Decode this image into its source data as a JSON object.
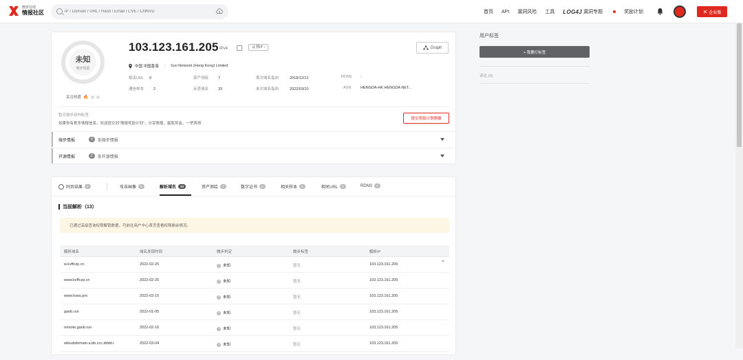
{
  "header": {
    "logo_top": "微步在线",
    "logo_main": "情报社区",
    "search_placeholder": "IP / Domain / URL / Hash / Email / CVE / CNNVD",
    "nav": [
      "首页",
      "API",
      "漏洞风险",
      "工具"
    ],
    "log4j_label": "LOG4J",
    "log4j_suffix": "漏洞专题",
    "reward": "奖励计划",
    "enterprise": "企业版"
  },
  "ip_card": {
    "ip": "103.123.161.205",
    "ip_version": "IPv4",
    "claim": "认领IP",
    "graph": "Graph",
    "verdict": "未知",
    "verdict_sub": "微步情报",
    "heat_label": "关注热度",
    "location": "中国 中国香港",
    "org": "Sun Network (Hong Kong) Limited",
    "info": {
      "related_url_label": "相关URL",
      "related_url": "0",
      "asset_label": "资产测绘",
      "asset": "7",
      "first_label": "首次域名指向",
      "first": "2018/12/12",
      "rdns_label": "RDNS",
      "rdns": "-",
      "sample_label": "通信样本",
      "sample": "2",
      "reverse_label": "反查域名",
      "reverse": "33",
      "last_label": "末次域名指向",
      "last": "2022/03/10",
      "asn_label": "ASN",
      "asn": "HENGDA-HK HENGDA NET..."
    },
    "tag_hint": "暂无微步研判标签",
    "tag_desc": "如果你有更多情报信息，欢迎提交到\"情报奖励计划\"，分享情报，赢取奖金，一举两得",
    "submit": "提交奖励计划情报",
    "accordion": [
      {
        "title": "微步情报",
        "count": "4",
        "text": "条微步情报"
      },
      {
        "title": "开源情报",
        "count": "2",
        "text": "条开源情报"
      }
    ]
  },
  "sidebar": {
    "title": "用户标签",
    "tag_button": "+ 我要打标签",
    "comments": "评论 (0)"
  },
  "tabs": [
    {
      "label": "同页结果",
      "count": "6"
    },
    {
      "label": "攻击画像",
      "count": "0"
    },
    {
      "label": "解析域名",
      "count": "33"
    },
    {
      "label": "资产测绘",
      "count": "7"
    },
    {
      "label": "数字证书",
      "count": "0"
    },
    {
      "label": "相关样本",
      "count": "2"
    },
    {
      "label": "相关URL",
      "count": "0"
    },
    {
      "label": "RDNS",
      "count": "0"
    }
  ],
  "section_title": "当前解析（13）",
  "notice": "已通过高级查询权限解锁数据，可前往用户中心首页查看权限剩余情况。",
  "table": {
    "headers": [
      "解析域名",
      "域名发现时间",
      "微步判定",
      "微步标签",
      "解析IP"
    ],
    "rows": [
      [
        "w.kvffczp.cn",
        "2022-02-25",
        "未知",
        "暂无",
        "103.123.161.205"
      ],
      [
        "www.kvffczp.cn",
        "2022-02-25",
        "未知",
        "暂无",
        "103.123.161.205"
      ],
      [
        "www.hses.pro",
        "2022-03-10",
        "未知",
        "暂无",
        "103.123.161.205"
      ],
      [
        "ganb.run",
        "2022-01-05",
        "未知",
        "暂无",
        "103.123.161.205"
      ],
      [
        "remote.ganb.run",
        "2022-02-16",
        "未知",
        "暂无",
        "103.123.161.205"
      ],
      [
        "wbsubdomain.a.bb.ccc.dddd.r",
        "2022-03-04",
        "未知",
        "暂无",
        "103.123.161.205"
      ]
    ]
  },
  "colors": {
    "brand": "#e0291e",
    "dark_button": "#606266",
    "notice_bg": "#fdf6e5"
  },
  "icons": [
    "search-icon",
    "cloud-icon",
    "bell-icon",
    "copy-icon",
    "graph-icon",
    "pin-icon",
    "globe-icon",
    "caret-down-icon",
    "question-icon"
  ]
}
